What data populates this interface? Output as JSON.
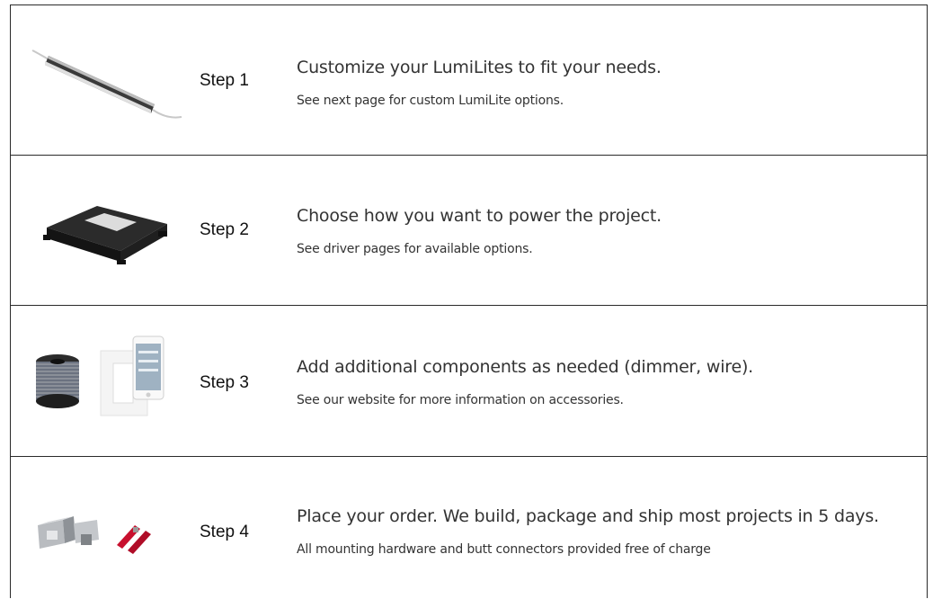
{
  "steps": [
    {
      "label": "Step 1",
      "headline": "Customize your LumiLites to fit your needs.",
      "sub": "See next page for custom LumiLite options.",
      "image": "led-light-bar-icon"
    },
    {
      "label": "Step 2",
      "headline": "Choose how you want to power the project.",
      "sub": "See driver pages for available options.",
      "image": "led-driver-icon"
    },
    {
      "label": "Step 3",
      "headline": "Add additional components as needed (dimmer, wire).",
      "sub": "See our website for more information on accessories.",
      "image": "wire-spool-and-dimmer-icon"
    },
    {
      "label": "Step 4",
      "headline": "Place your order. We build, package and ship most projects in 5 days.",
      "sub": "All mounting hardware and butt connectors provided free of charge",
      "image": "mounting-hardware-and-connectors-icon"
    }
  ]
}
